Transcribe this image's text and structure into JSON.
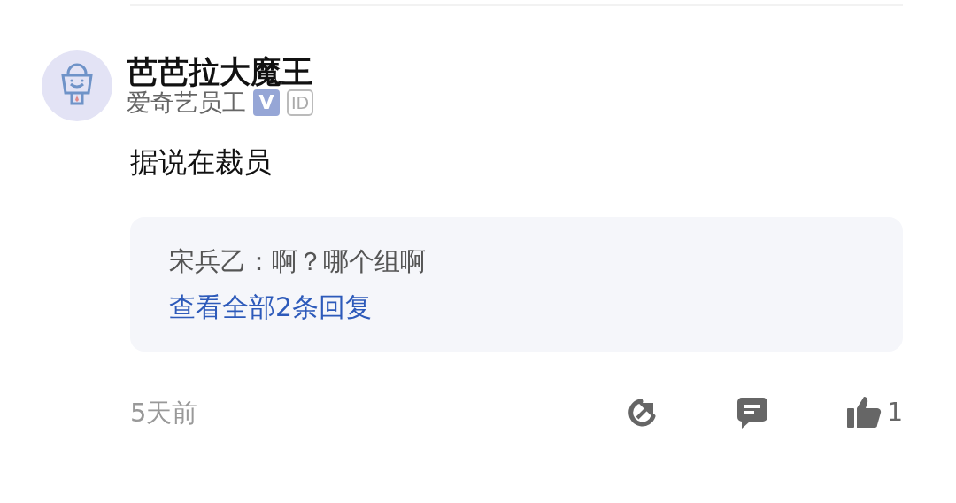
{
  "author": {
    "name": "芭芭拉大魔王",
    "title": "爱奇艺员工",
    "badges": [
      {
        "kind": "verified",
        "label": "V"
      },
      {
        "kind": "id",
        "label": "ID"
      }
    ]
  },
  "content": "据说在裁员",
  "replies": {
    "preview": [
      {
        "author": "宋兵乙",
        "text": "：啊？哪个组啊"
      }
    ],
    "view_all": "查看全部2条回复"
  },
  "footer": {
    "time": "5天前",
    "like_count": "1"
  }
}
